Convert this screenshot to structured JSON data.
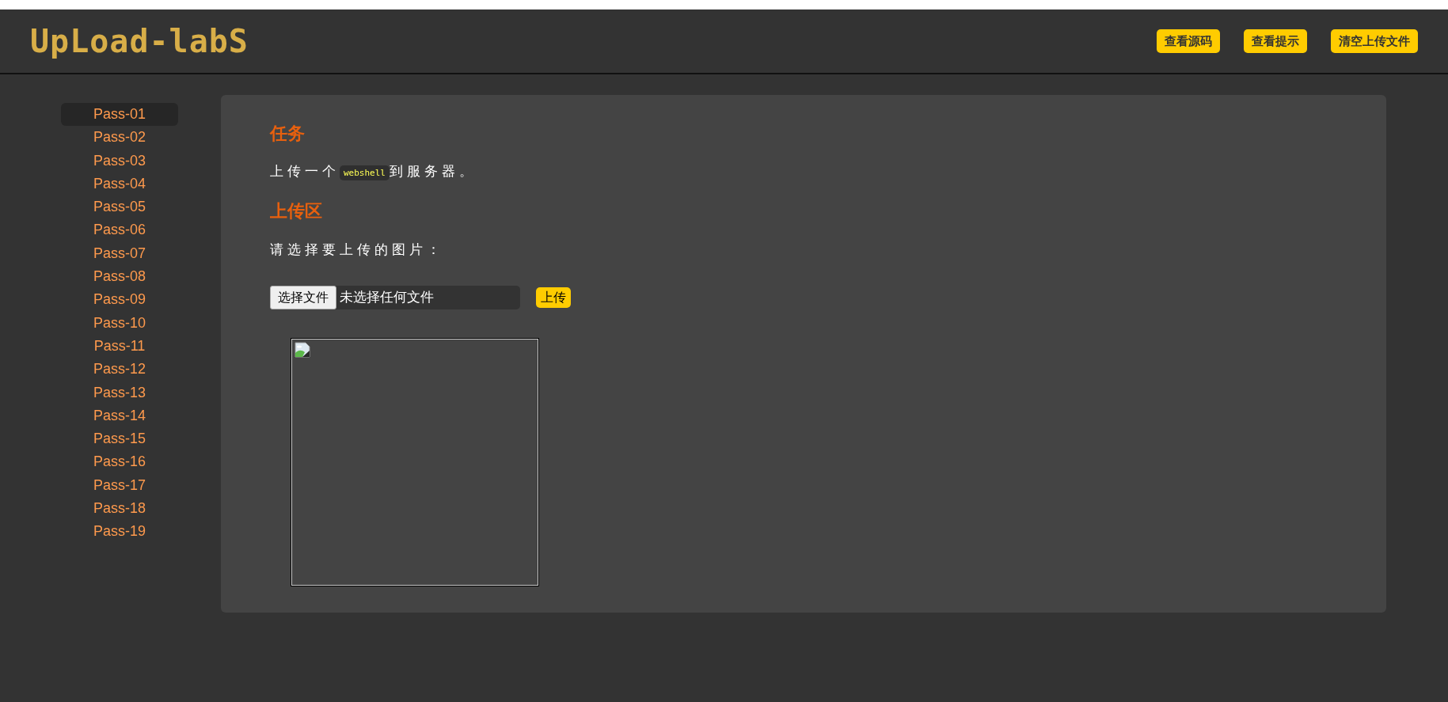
{
  "header": {
    "logo": "UpLoad-labS",
    "buttons": [
      "查看源码",
      "查看提示",
      "清空上传文件"
    ]
  },
  "sidebar": {
    "items": [
      {
        "label": "Pass-01",
        "selected": true
      },
      {
        "label": "Pass-02",
        "selected": false
      },
      {
        "label": "Pass-03",
        "selected": false
      },
      {
        "label": "Pass-04",
        "selected": false
      },
      {
        "label": "Pass-05",
        "selected": false
      },
      {
        "label": "Pass-06",
        "selected": false
      },
      {
        "label": "Pass-07",
        "selected": false
      },
      {
        "label": "Pass-08",
        "selected": false
      },
      {
        "label": "Pass-09",
        "selected": false
      },
      {
        "label": "Pass-10",
        "selected": false
      },
      {
        "label": "Pass-11",
        "selected": false
      },
      {
        "label": "Pass-12",
        "selected": false
      },
      {
        "label": "Pass-13",
        "selected": false
      },
      {
        "label": "Pass-14",
        "selected": false
      },
      {
        "label": "Pass-15",
        "selected": false
      },
      {
        "label": "Pass-16",
        "selected": false
      },
      {
        "label": "Pass-17",
        "selected": false
      },
      {
        "label": "Pass-18",
        "selected": false
      },
      {
        "label": "Pass-19",
        "selected": false
      }
    ]
  },
  "task": {
    "heading": "任务",
    "text_before": "上传一个",
    "code": "webshell",
    "text_after": "到服务器。"
  },
  "upload": {
    "heading": "上传区",
    "prompt": "请选择要上传的图片：",
    "choose_button": "选择文件",
    "file_status": "未选择任何文件",
    "submit": "上传"
  },
  "preview": {
    "kind": "broken-image"
  }
}
